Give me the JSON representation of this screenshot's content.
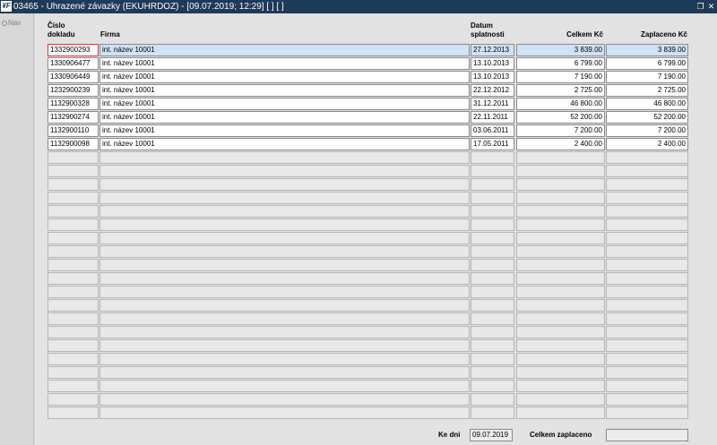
{
  "window": {
    "logo": "¥F",
    "title": "03465 - Uhrazené závazky (EKUHRDOZ) - [09.07.2019; 12:29]  [ ]  [ ]",
    "restore_icon": "restore-icon",
    "close_icon": "close-icon"
  },
  "nav": {
    "label": "Nav"
  },
  "headers": {
    "cislo": "Číslo",
    "dokladu": "dokladu",
    "firma": "Firma",
    "datum": "Datum",
    "splatnosti": "splatnosti",
    "celkem": "Celkem Kč",
    "zaplaceno": "Zaplaceno Kč"
  },
  "rows": [
    {
      "doklad": "1332900293",
      "firma": "int. název 10001",
      "datum": "27.12.2013",
      "celkem": "3 839.00",
      "zaplaceno": "3 839.00"
    },
    {
      "doklad": "1330906477",
      "firma": "int. název 10001",
      "datum": "13.10.2013",
      "celkem": "6 799.00",
      "zaplaceno": "6 799.00"
    },
    {
      "doklad": "1330906449",
      "firma": "int. název 10001",
      "datum": "13.10.2013",
      "celkem": "7 190.00",
      "zaplaceno": "7 190.00"
    },
    {
      "doklad": "1232900239",
      "firma": "int. název 10001",
      "datum": "22.12.2012",
      "celkem": "2 725.00",
      "zaplaceno": "2 725.00"
    },
    {
      "doklad": "1132900328",
      "firma": "int. název 10001",
      "datum": "31.12.2011",
      "celkem": "46 800.00",
      "zaplaceno": "46 800.00"
    },
    {
      "doklad": "1132900274",
      "firma": "int. název 10001",
      "datum": "22.11.2011",
      "celkem": "52 200.00",
      "zaplaceno": "52 200.00"
    },
    {
      "doklad": "1132900110",
      "firma": "int. název 10001",
      "datum": "03.06.2011",
      "celkem": "7 200.00",
      "zaplaceno": "7 200.00"
    },
    {
      "doklad": "1132900098",
      "firma": "int. název 10001",
      "datum": "17.05.2011",
      "celkem": "2 400.00",
      "zaplaceno": "2 400.00"
    }
  ],
  "empty_rows": 20,
  "footer": {
    "ke_dni_label": "Ke dni",
    "ke_dni_value": "09.07.2019",
    "celkem_zaplaceno_label": "Celkem  zaplaceno",
    "celkem_zaplaceno_value": ""
  },
  "colors": {
    "titlebar": "#1d3a56",
    "selected_row": "#cfe3f7",
    "focus_border": "#e03030"
  }
}
